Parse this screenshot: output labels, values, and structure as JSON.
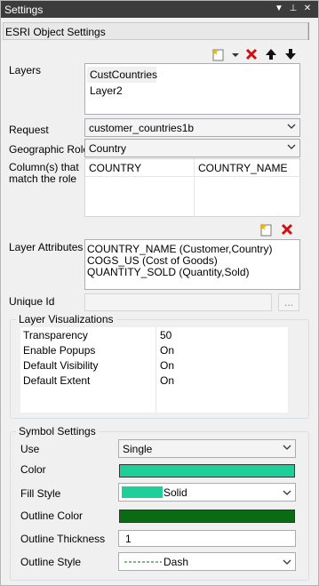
{
  "titlebar": {
    "title": "Settings"
  },
  "section": {
    "title": "ESRI Object Settings"
  },
  "layers": {
    "label": "Layers",
    "items": [
      "CustCountries",
      "Layer2"
    ]
  },
  "request": {
    "label": "Request",
    "value": "customer_countries1b"
  },
  "geo_role": {
    "label": "Geographic Role",
    "value": "Country"
  },
  "columns": {
    "label": "Column(s) that match the role",
    "headers": [
      "COUNTRY",
      "COUNTRY_NAME"
    ]
  },
  "layer_attributes": {
    "label": "Layer Attributes",
    "items": [
      "COUNTRY_NAME (Customer,Country)",
      "COGS_US (Cost of Goods)",
      "QUANTITY_SOLD (Quantity,Sold)"
    ]
  },
  "unique_id": {
    "label": "Unique Id",
    "value": "",
    "browse_label": "..."
  },
  "visualizations": {
    "title": "Layer Visualizations",
    "rows": [
      {
        "name": "Transparency",
        "value": "50"
      },
      {
        "name": "Enable Popups",
        "value": "On"
      },
      {
        "name": "Default Visibility",
        "value": "On"
      },
      {
        "name": "Default Extent",
        "value": "On"
      }
    ]
  },
  "symbol": {
    "title": "Symbol Settings",
    "use_label": "Use",
    "use_value": "Single",
    "color_label": "Color",
    "color": "#1fcf9a",
    "fill_label": "Fill Style",
    "fill_value": "Solid",
    "outline_color_label": "Outline Color",
    "outline_color": "#0b6a14",
    "thickness_label": "Outline Thickness",
    "thickness_value": "1",
    "outline_style_label": "Outline Style",
    "outline_style_value": "Dash"
  }
}
